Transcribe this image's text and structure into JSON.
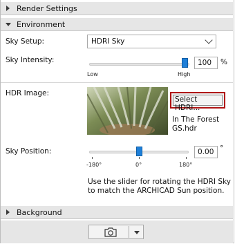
{
  "render_settings": {
    "title": "Render Settings"
  },
  "environment": {
    "title": "Environment",
    "sky_setup": {
      "label": "Sky Setup:",
      "value": "HDRI Sky"
    },
    "sky_intensity": {
      "label": "Sky Intensity:",
      "min_label": "Low",
      "max_label": "High",
      "value": "100",
      "unit": "%",
      "level": 1.0
    },
    "hdr_image": {
      "label": "HDR Image:",
      "select_button": "Select HDRI...",
      "file_line1": "In The Forest",
      "file_line2": "GS.hdr"
    },
    "sky_position": {
      "label": "Sky Position:",
      "tick_min": "-180°",
      "tick_mid": "0°",
      "tick_max": "180°",
      "value": "0.00",
      "unit": "°",
      "level": 0.5
    },
    "help_line1": "Use the slider for rotating the HDRI Sky",
    "help_line2": "to match the ARCHICAD Sun position."
  },
  "background": {
    "title": "Background"
  },
  "camera_button": {
    "icon": "camera-icon",
    "dropdown_icon": "triangle-down-icon"
  },
  "colors": {
    "section_bg": "#e6e6e6",
    "accent": "#1e7fd8",
    "highlight_border": "#b01212"
  }
}
